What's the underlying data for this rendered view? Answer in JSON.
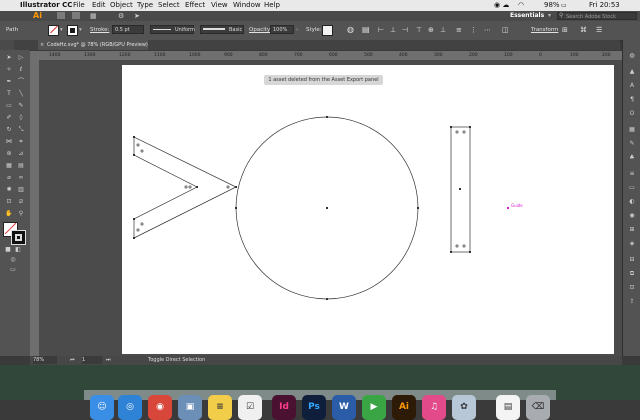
{
  "menubar": {
    "app_name": "Illustrator CC",
    "menus": [
      "File",
      "Edit",
      "Object",
      "Type",
      "Select",
      "Effect",
      "View",
      "Window",
      "Help"
    ],
    "workspace": "Essentials",
    "search_placeholder": "Search Adobe Stock",
    "battery": "98%",
    "clock": "Fri 20:53"
  },
  "control_bar": {
    "selection_label": "Path",
    "stroke_label": "Stroke:",
    "stroke_value": "0.5 pt",
    "profile_value": "Uniform",
    "brush_value": "Basic",
    "opacity_label": "Opacity:",
    "opacity_value": "100%",
    "style_label": "Style:",
    "transform_label": "Transform"
  },
  "document_tab": {
    "close": "×",
    "title": "CodeHz.svg* @ 78% (RGB/GPU Preview)"
  },
  "ruler_labels": [
    "1400",
    "1300",
    "1200",
    "1100",
    "1000",
    "900",
    "800",
    "700",
    "600",
    "500",
    "400",
    "300",
    "200",
    "100",
    "0",
    "100",
    "200"
  ],
  "notification": "1 asset deleted from the Asset Export panel",
  "artwork": {
    "guide_label": "Guide"
  },
  "status_bar": {
    "zoom": "78%",
    "artboard_number": "1",
    "tool_name": "Toggle Direct Selection"
  },
  "dock": {
    "apps": [
      {
        "name": "Finder",
        "glyph": "☺",
        "color": "#3a8ee6"
      },
      {
        "name": "Safari",
        "glyph": "◎",
        "color": "#2f83d6"
      },
      {
        "name": "Chrome",
        "glyph": "◉",
        "color": "#d9473b"
      },
      {
        "name": "Preview",
        "glyph": "▣",
        "color": "#6c8fb8"
      },
      {
        "name": "Notes",
        "glyph": "≡",
        "color": "#f2cd4a"
      },
      {
        "name": "Reminders",
        "glyph": "☑",
        "color": "#f0f0f0"
      },
      {
        "name": "InDesign",
        "glyph": "Id",
        "color": "#4a1230"
      },
      {
        "name": "Photoshop",
        "glyph": "Ps",
        "color": "#0f1e3a"
      },
      {
        "name": "Word",
        "glyph": "W",
        "color": "#2b5ca8"
      },
      {
        "name": "FaceTime",
        "glyph": "▶",
        "color": "#3aa545"
      },
      {
        "name": "Illustrator",
        "glyph": "Ai",
        "color": "#2d1a07"
      },
      {
        "name": "iTunes",
        "glyph": "♫",
        "color": "#e24a8a"
      },
      {
        "name": "Photos",
        "glyph": "✿",
        "color": "#b8c7d8"
      },
      {
        "name": "Documents",
        "glyph": "▤",
        "color": "#f4f4f4"
      },
      {
        "name": "Trash",
        "glyph": "⌫",
        "color": "#a8acb0"
      }
    ]
  }
}
